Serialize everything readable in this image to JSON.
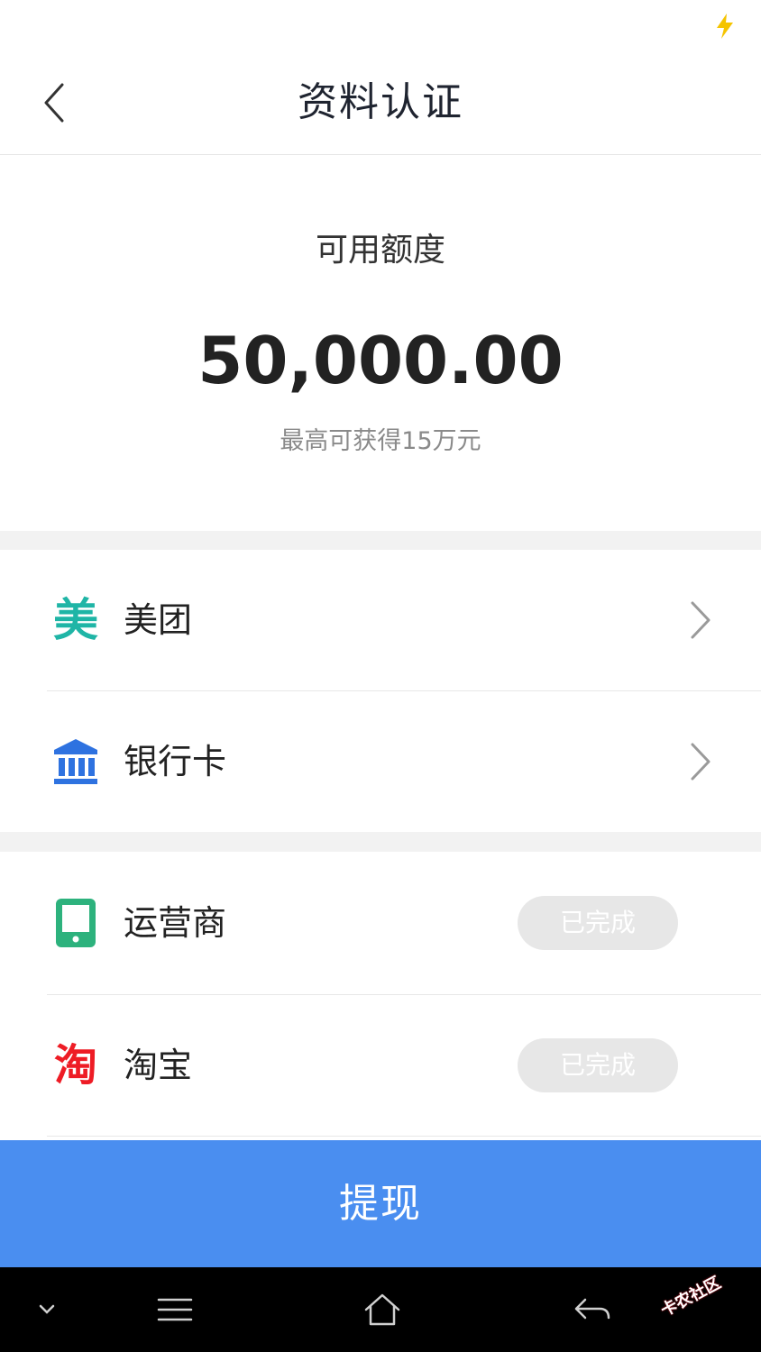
{
  "topbar": {
    "title": "资料认证"
  },
  "credit": {
    "label": "可用额度",
    "amount": "50,000.00",
    "subtitle": "最高可获得15万元"
  },
  "sections": {
    "auth_items": [
      {
        "icon": "meituan-icon",
        "glyph": "美",
        "label": "美团",
        "color": "#1fb5a6"
      },
      {
        "icon": "bank-icon",
        "label": "银行卡",
        "color": "#2e72e0"
      }
    ],
    "completed_items": [
      {
        "icon": "carrier-phone-icon",
        "label": "运营商",
        "status": "已完成",
        "color": "#2db27d"
      },
      {
        "icon": "taobao-icon",
        "glyph": "淘",
        "label": "淘宝",
        "status": "已完成",
        "color": "#ee1c25"
      }
    ]
  },
  "action": {
    "withdraw_label": "提现"
  },
  "watermark": {
    "text": "卡农社区"
  }
}
